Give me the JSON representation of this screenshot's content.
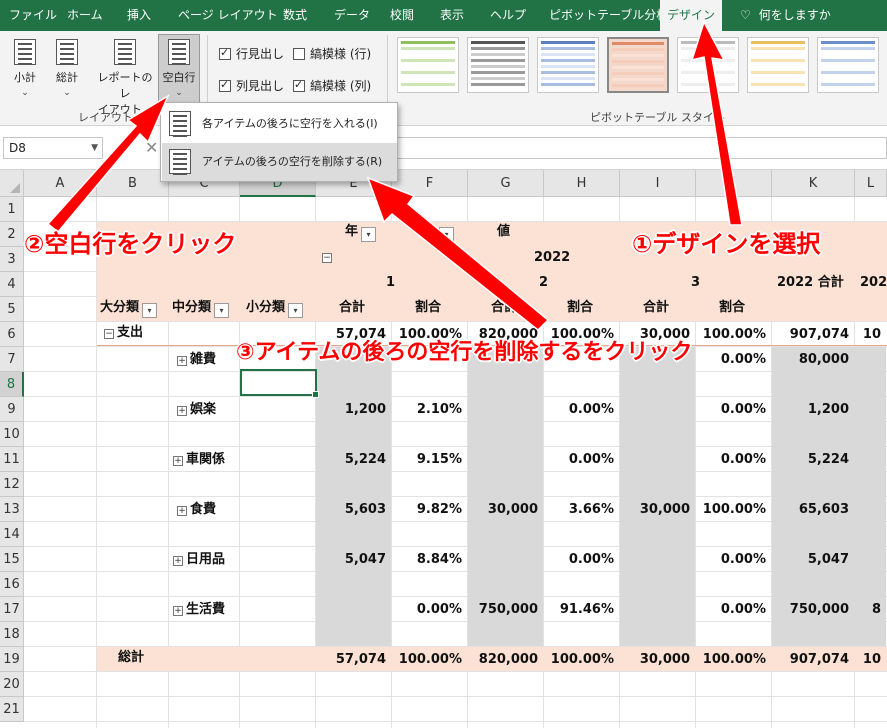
{
  "tabs": [
    {
      "label": "ファイル"
    },
    {
      "label": "ホーム"
    },
    {
      "label": "挿入"
    },
    {
      "label": "ページ レイアウト"
    },
    {
      "label": "数式"
    },
    {
      "label": "データ"
    },
    {
      "label": "校閲"
    },
    {
      "label": "表示"
    },
    {
      "label": "ヘルプ"
    },
    {
      "label": "ピボットテーブル分析"
    },
    {
      "label": "デザイン"
    }
  ],
  "tell_me": "何をしますか",
  "ribbon": {
    "layout": {
      "subtotal": "小計",
      "grand_total": "総計",
      "report_layout_1": "レポートのレ",
      "report_layout_2": "イアウト",
      "blank_rows": "空白行",
      "group_label": "レイアウト"
    },
    "options": {
      "row_headers": "行見出し",
      "banded_rows": "縞模様 (行)",
      "col_headers": "列見出し",
      "banded_cols": "縞模様 (列)"
    },
    "styles_label": "ピボットテーブル スタイル"
  },
  "name_box": "D8",
  "menu": {
    "insert": "各アイテムの後ろに空行を入れる(I)",
    "remove": "アイテムの後ろの空行を削除する(R)"
  },
  "columns": [
    "A",
    "B",
    "C",
    "D",
    "E",
    "F",
    "G",
    "H",
    "I",
    "J",
    "K",
    "L"
  ],
  "rows": [
    "1",
    "2",
    "3",
    "4",
    "5",
    "6",
    "7",
    "8",
    "9",
    "10",
    "11",
    "12",
    "13",
    "14",
    "15",
    "16",
    "17",
    "18",
    "19",
    "20",
    "21"
  ],
  "pivot": {
    "year_label": "年",
    "month_label": "月",
    "value_label": "値",
    "year_2022": "2022",
    "m1": "1",
    "m2": "2",
    "m3": "3",
    "total_2022": "2022 合計",
    "total_2022_cut": "202",
    "cat_major": "大分類",
    "cat_mid": "中分類",
    "cat_minor": "小分類",
    "sum": "合計",
    "ratio": "割合",
    "expense": "支出",
    "row6": [
      "57,074",
      "100.00%",
      "820,000",
      "100.00%",
      "30,000",
      "100.00%",
      "907,074",
      "10"
    ],
    "items": [
      {
        "name": "雑費",
        "vals": [
          "",
          "",
          "",
          "",
          "",
          "0.00%",
          "80,000",
          ""
        ]
      },
      {
        "name": "娯楽",
        "vals": [
          "1,200",
          "2.10%",
          "",
          "0.00%",
          "",
          "0.00%",
          "1,200",
          ""
        ]
      },
      {
        "name": "車関係",
        "vals": [
          "5,224",
          "9.15%",
          "",
          "0.00%",
          "",
          "0.00%",
          "5,224",
          ""
        ]
      },
      {
        "name": "食費",
        "vals": [
          "5,603",
          "9.82%",
          "30,000",
          "3.66%",
          "30,000",
          "100.00%",
          "65,603",
          ""
        ]
      },
      {
        "name": "日用品",
        "vals": [
          "5,047",
          "8.84%",
          "",
          "0.00%",
          "",
          "0.00%",
          "5,047",
          ""
        ]
      },
      {
        "name": "生活費",
        "vals": [
          "",
          "0.00%",
          "750,000",
          "91.46%",
          "",
          "0.00%",
          "750,000",
          "8"
        ]
      }
    ],
    "grand_total": "総計",
    "row19": [
      "57,074",
      "100.00%",
      "820,000",
      "100.00%",
      "30,000",
      "100.00%",
      "907,074",
      "10"
    ]
  },
  "annotations": {
    "a1": "①デザインを選択",
    "a2": "②空白行をクリック",
    "a3": "③アイテムの後ろの空行を削除するをクリック"
  },
  "colors": {
    "excel_green": "#217346",
    "pivot_header": "#fbe2d5",
    "pivot_shade": "#d9d9d9",
    "annotation_red": "#ff0000"
  }
}
